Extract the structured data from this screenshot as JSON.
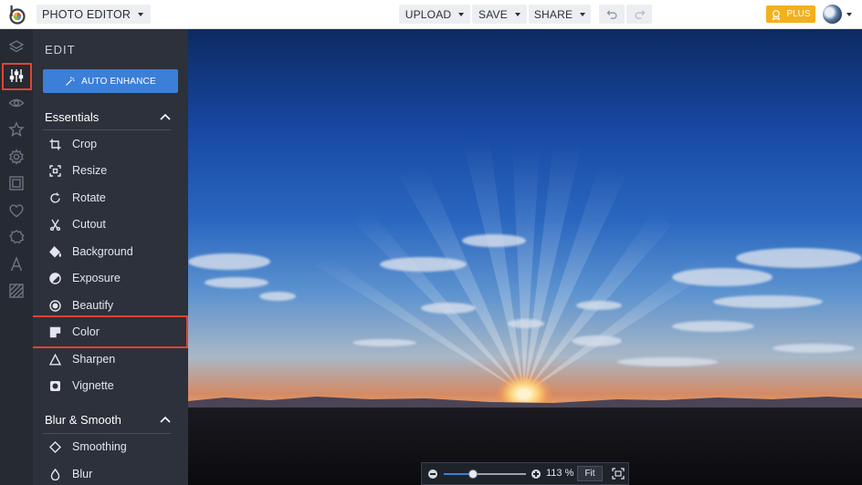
{
  "topbar": {
    "app_menu_label": "PHOTO EDITOR",
    "upload_label": "UPLOAD",
    "save_label": "SAVE",
    "share_label": "SHARE",
    "plus_label": "PLUS",
    "accent_color": "#f2b01e"
  },
  "rail": {
    "icons": [
      "layers-icon",
      "sliders-icon",
      "eye-icon",
      "star-icon",
      "gear-icon",
      "frame-icon",
      "heart-icon",
      "badge-icon",
      "text-icon",
      "texture-icon"
    ],
    "active": "sliders-icon"
  },
  "panel": {
    "title": "EDIT",
    "auto_enhance_label": "AUTO ENHANCE",
    "sections": [
      {
        "name": "Essentials",
        "expanded": true,
        "tools": [
          "Crop",
          "Resize",
          "Rotate",
          "Cutout",
          "Background",
          "Exposure",
          "Beautify",
          "Color",
          "Sharpen",
          "Vignette"
        ]
      },
      {
        "name": "Blur & Smooth",
        "expanded": true,
        "tools": [
          "Smoothing",
          "Blur"
        ]
      }
    ],
    "highlighted_tool": "Color",
    "highlight_color": "#e4432f",
    "button_color": "#3b7fd8"
  },
  "zoom": {
    "percent_label": "113 %",
    "fit_label": "Fit",
    "slider_fraction": 0.36
  }
}
